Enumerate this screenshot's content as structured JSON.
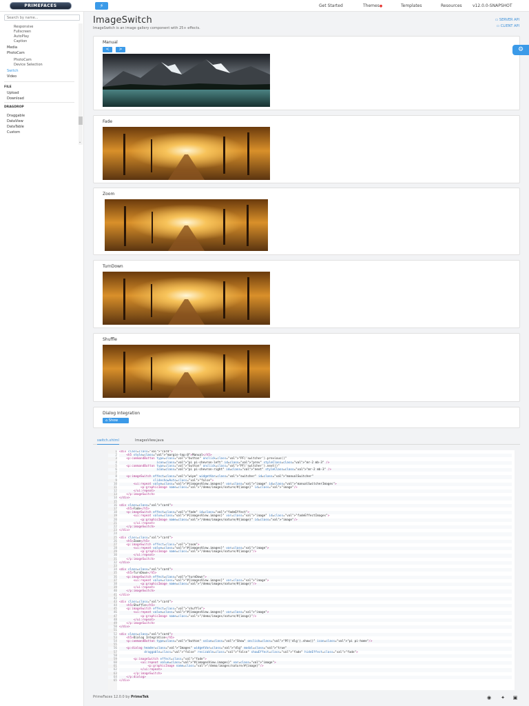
{
  "topbar": {
    "logo": "PRIMEFACES",
    "theme_button": "⚡",
    "nav": [
      "Get Started",
      "Themes",
      "Templates",
      "Resources",
      "v12.0.0-SNAPSHOT"
    ]
  },
  "sidebar": {
    "search_placeholder": "Search by name...",
    "items": [
      {
        "label": "Responsive",
        "level": 2
      },
      {
        "label": "Fullscreen",
        "level": 2
      },
      {
        "label": "AutoPlay",
        "level": 2
      },
      {
        "label": "Caption",
        "level": 2
      },
      {
        "label": "Media",
        "level": 1
      },
      {
        "label": "PhotoCam",
        "level": 1
      },
      {
        "label": "PhotoCam",
        "level": 2
      },
      {
        "label": "Device Selection",
        "level": 2
      },
      {
        "label": "Switch",
        "level": 1,
        "active": true
      },
      {
        "label": "Video",
        "level": 1
      },
      {
        "label": "FILE",
        "level": 0
      },
      {
        "label": "Upload",
        "level": 1
      },
      {
        "label": "Download",
        "level": 1
      },
      {
        "label": "DRAGDROP",
        "level": 0
      },
      {
        "label": "Draggable",
        "level": 1
      },
      {
        "label": "DataView",
        "level": 1
      },
      {
        "label": "DataTable",
        "level": 1
      },
      {
        "label": "Custom",
        "level": 1
      }
    ]
  },
  "page": {
    "title": "ImageSwitch",
    "subtitle": "ImageSwitch is an image gallery component with 25+ effects.",
    "server_api": "SERVER API",
    "client_api": "CLIENT API"
  },
  "cards": [
    {
      "title": "Manual",
      "prev": "<",
      "next": ">"
    },
    {
      "title": "Fade"
    },
    {
      "title": "Zoom"
    },
    {
      "title": "TurnDown"
    },
    {
      "title": "Shuffle"
    },
    {
      "title": "Dialog Integration",
      "button": "Show"
    }
  ],
  "tabs": [
    "switch.xhtml",
    "ImagesView.java"
  ],
  "code_lines": [
    "<div class=\"card\">",
    "    <h5 style=\"margin-top:0\">Manual</h5>",
    "    <p:commandButton type=\"button\" onclick=\"PF('switcher').previous()\"",
    "                     icon=\"pi pi-chevron-left\" id=\"prev\" styleClass=\"mr-2 mb-3\" />",
    "    <p:commandButton type=\"button\" onclick=\"PF('switcher').next()\"",
    "                     icon=\"pi pi-chevron-right\" id=\"next\" styleClass=\"mr-2 mb-3\" />",
    "",
    "    <p:imageSwitch effect=\"wipe\" widgetVar=\"switcher\" id=\"manualSwitcher\"",
    "                   slideshowAuto=\"false\">",
    "        <ui:repeat value=\"#{imagesView.images}\" var=\"image\" id=\"manualSwitcherImages\">",
    "            <p:graphicImage name=\"/demo/images/nature/#{image}\" id=\"image\"/>",
    "        </ui:repeat>",
    "    </p:imageSwitch>",
    "</div>",
    "",
    "<div class=\"card\">",
    "    <h5>Fade</h5>",
    "    <p:imageSwitch effect=\"fade\" id=\"fadeEffect\">",
    "        <ui:repeat value=\"#{imagesView.images}\" var=\"image\" id=\"fadeEffectImages\">",
    "            <p:graphicImage name=\"/demo/images/nature/#{image}\" id=\"image\"/>",
    "        </ui:repeat>",
    "    </p:imageSwitch>",
    "</div>",
    "",
    "<div class=\"card\">",
    "    <h5>Zoom</h5>",
    "    <p:imageSwitch effect=\"zoom\">",
    "        <ui:repeat value=\"#{imagesView.images}\" var=\"image\">",
    "            <p:graphicImage name=\"/demo/images/nature/#{image}\"/>",
    "        </ui:repeat>",
    "    </p:imageSwitch>",
    "</div>",
    "",
    "<div class=\"card\">",
    "    <h5>TurnDown</h5>",
    "    <p:imageSwitch effect=\"turnDown\">",
    "        <ui:repeat value=\"#{imagesView.images}\" var=\"image\">",
    "            <p:graphicImage name=\"/demo/images/nature/#{image}\"/>",
    "        </ui:repeat>",
    "    </p:imageSwitch>",
    "</div>",
    "",
    "<div class=\"card\">",
    "    <h5>Shuffle</h5>",
    "    <p:imageSwitch effect=\"shuffle\">",
    "        <ui:repeat value=\"#{imagesView.images}\" var=\"image\">",
    "            <p:graphicImage name=\"/demo/images/nature/#{image}\"/>",
    "        </ui:repeat>",
    "    </p:imageSwitch>",
    "</div>",
    "",
    "<div class=\"card\">",
    "    <h5>Dialog Integration</h5>",
    "    <p:commandButton type=\"button\" value=\"Show\" onclick=\"PF('dlg').show()\" icon=\"pi pi-home\"/>",
    "",
    "    <p:dialog header=\"Images\" widgetVar=\"dlg\" modal=\"true\"",
    "              draggable=\"false\" resizable=\"false\" showEffect=\"fade\" hideEffect=\"fade\">",
    "",
    "        <p:imageSwitch effect=\"fade\">",
    "            <ui:repeat value=\"#{imagesView.images}\" var=\"image\">",
    "                <p:graphicImage name=\"/demo/images/nature/#{image}\"/>",
    "            </ui:repeat>",
    "        </p:imageSwitch>",
    "    </p:dialog>",
    "</div>"
  ],
  "footer": {
    "text": "PrimeFaces 12.0.0 by",
    "brand": "PrimeTek"
  },
  "icons": {
    "github": "github-icon",
    "twitter": "twitter-icon",
    "forum": "forum-icon",
    "settings": "settings-icon"
  },
  "colors": {
    "accent": "#3b9ae8",
    "background": "#f2f3f5"
  }
}
